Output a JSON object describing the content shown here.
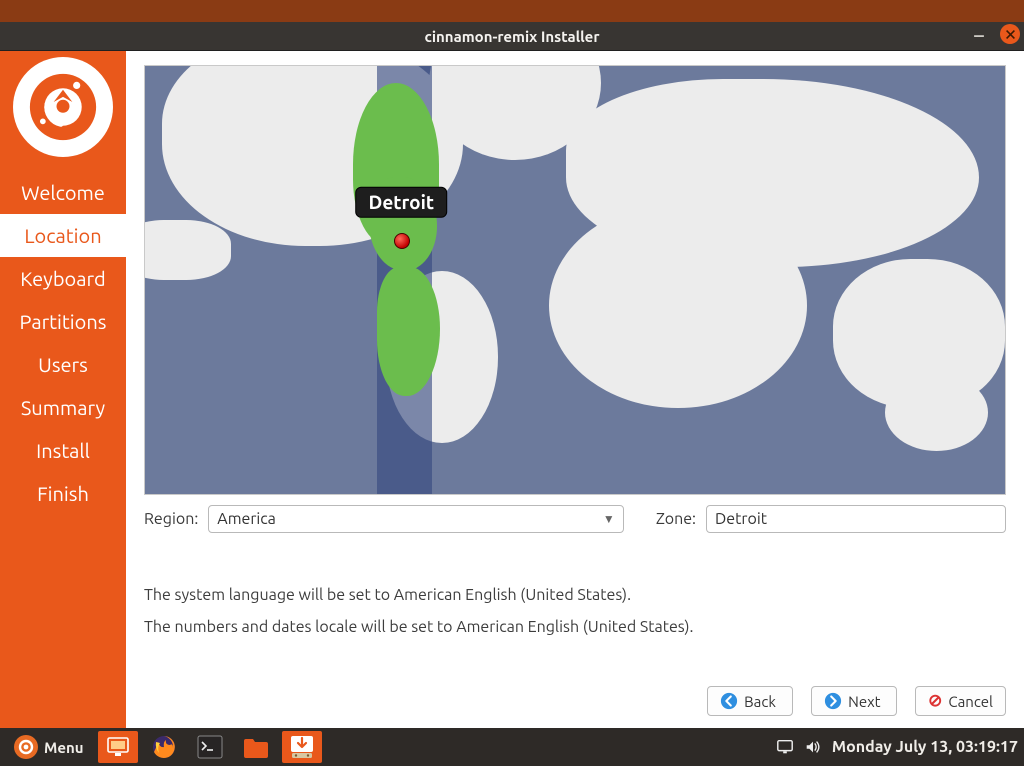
{
  "window": {
    "title": "cinnamon-remix Installer"
  },
  "sidebar": {
    "steps": [
      {
        "label": "Welcome"
      },
      {
        "label": "Location"
      },
      {
        "label": "Keyboard"
      },
      {
        "label": "Partitions"
      },
      {
        "label": "Users"
      },
      {
        "label": "Summary"
      },
      {
        "label": "Install"
      },
      {
        "label": "Finish"
      }
    ],
    "active_index": 1
  },
  "location": {
    "pin_label": "Detroit",
    "region_label": "Region:",
    "region_value": "America",
    "zone_label": "Zone:",
    "zone_value": "Detroit"
  },
  "info": {
    "lang": "The system language will be set to American English (United States).",
    "locale": "The numbers and dates locale will be set to American English (United States)."
  },
  "nav": {
    "back": "Back",
    "next": "Next",
    "cancel": "Cancel"
  },
  "taskbar": {
    "menu_label": "Menu",
    "datetime": "Monday July 13, 03:19:17"
  }
}
